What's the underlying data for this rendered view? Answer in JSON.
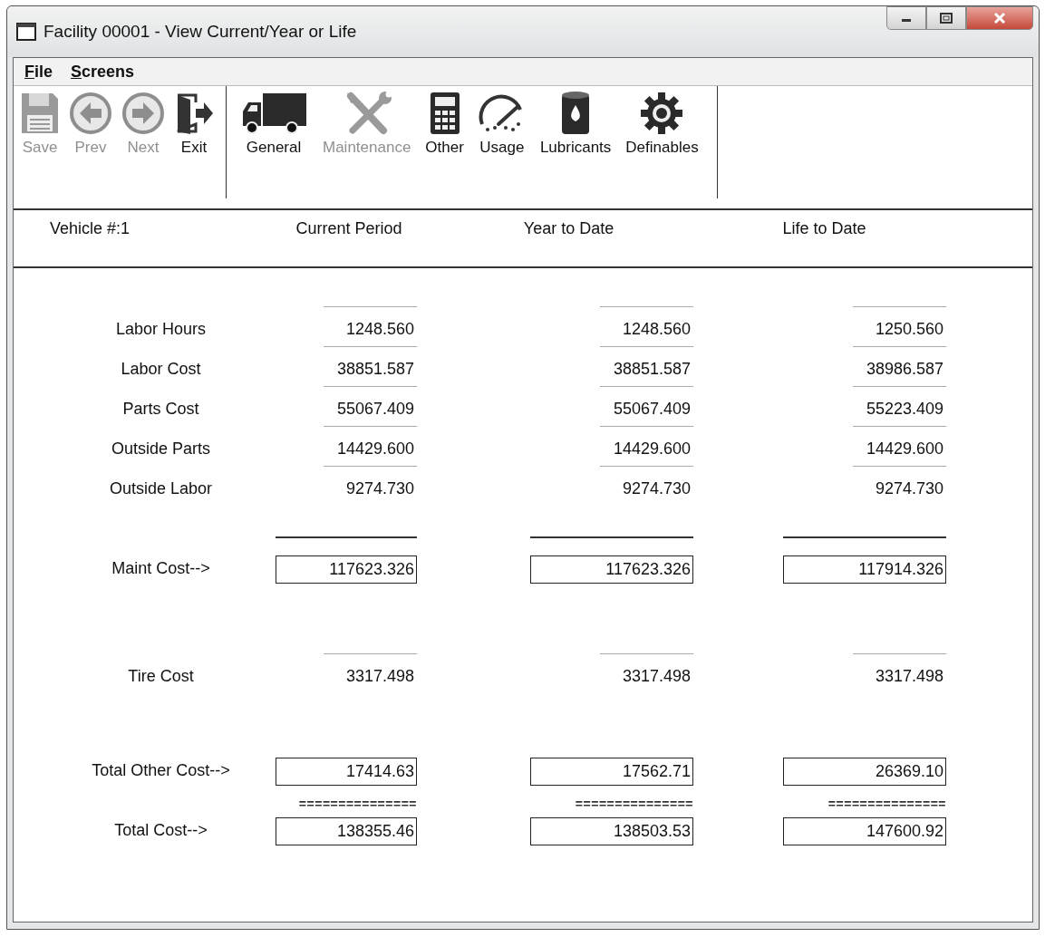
{
  "window": {
    "title": "Facility 00001 - View Current/Year or Life"
  },
  "menu": [
    {
      "label": "File"
    },
    {
      "label": "Screens"
    }
  ],
  "toolbar": [
    {
      "items": [
        {
          "label": "Save",
          "disabled": true
        },
        {
          "label": "Prev",
          "disabled": true
        },
        {
          "label": "Next",
          "disabled": true
        },
        {
          "label": "Exit",
          "disabled": false
        }
      ]
    },
    {
      "items": [
        {
          "label": "General",
          "disabled": false
        },
        {
          "label": "Maintenance",
          "disabled": true
        },
        {
          "label": "Other",
          "disabled": false
        },
        {
          "label": "Usage",
          "disabled": false
        },
        {
          "label": "Lubricants",
          "disabled": false
        },
        {
          "label": "Definables",
          "disabled": false
        }
      ]
    }
  ],
  "header": {
    "vehicle": "Vehicle #:1",
    "columns": [
      "Current Period",
      "Year to Date",
      "Life to Date"
    ]
  },
  "rows": [
    {
      "kind": "value",
      "label": "Labor Hours",
      "values": [
        "1248.560",
        "1248.560",
        "1250.560"
      ]
    },
    {
      "kind": "value",
      "label": "Labor Cost",
      "values": [
        "38851.587",
        "38851.587",
        "38986.587"
      ]
    },
    {
      "kind": "value",
      "label": "Parts Cost",
      "values": [
        "55067.409",
        "55067.409",
        "55223.409"
      ]
    },
    {
      "kind": "value",
      "label": "Outside Parts",
      "values": [
        "14429.600",
        "14429.600",
        "14429.600"
      ]
    },
    {
      "kind": "value",
      "label": "Outside Labor",
      "values": [
        "9274.730",
        "9274.730",
        "9274.730"
      ]
    },
    {
      "kind": "rule"
    },
    {
      "kind": "boxed",
      "label": "Maint Cost-->",
      "values": [
        "117623.326",
        "117623.326",
        "117914.326"
      ]
    },
    {
      "kind": "value",
      "label": "Tire Cost",
      "values": [
        "3317.498",
        "3317.498",
        "3317.498"
      ]
    },
    {
      "kind": "boxed",
      "label": "Total Other Cost-->",
      "values": [
        "17414.63",
        "17562.71",
        "26369.10"
      ]
    },
    {
      "kind": "separator",
      "values": [
        "===============",
        "===============",
        "==============="
      ]
    },
    {
      "kind": "boxed",
      "label": "Total Cost-->",
      "values": [
        "138355.46",
        "138503.53",
        "147600.92"
      ]
    }
  ]
}
